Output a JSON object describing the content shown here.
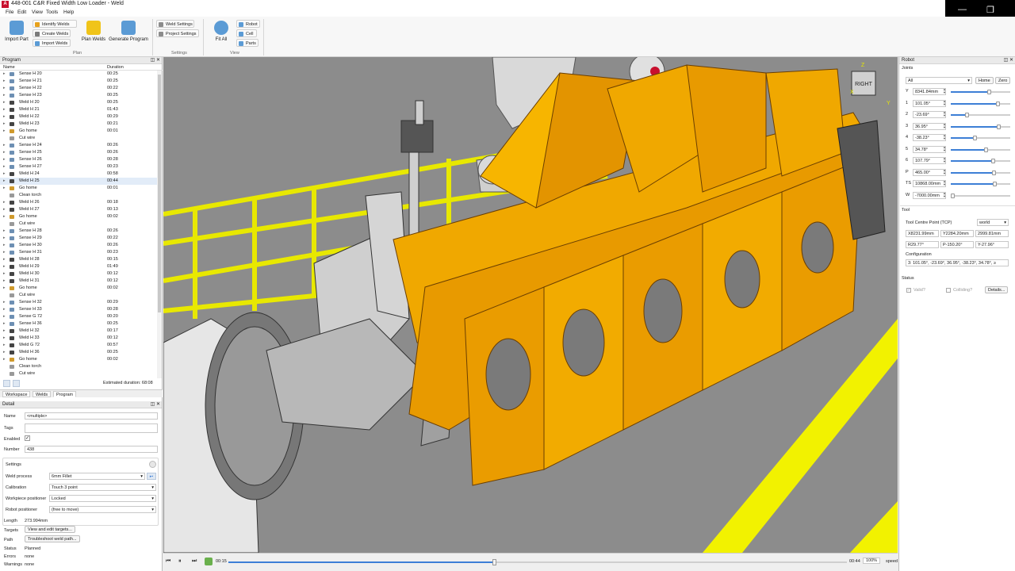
{
  "window": {
    "title": "448-001 C&R Fixed Width Low Loader - Weld",
    "app_icon": "A",
    "minimize": "—",
    "restore": "❐"
  },
  "menu": [
    "File",
    "Edit",
    "View",
    "Tools",
    "Help"
  ],
  "ribbon": {
    "import_part": "Import Part",
    "identify_welds": "Identify Welds",
    "create_welds": "Create Welds",
    "import_welds": "Import Welds",
    "plan_welds": "Plan Welds",
    "generate_program": "Generate Program",
    "group_plan": "Plan",
    "weld_settings": "Weld Settings",
    "project_settings": "Project Settings",
    "group_settings": "Settings",
    "fit_all": "Fit All",
    "robot": "Robot",
    "cell": "Cell",
    "parts": "Parts",
    "group_view": "View"
  },
  "program": {
    "title": "Program",
    "col_name": "Name",
    "col_duration": "Duration",
    "rows": [
      {
        "name": "Sense H 20",
        "duration": "00:25",
        "kind": "sense"
      },
      {
        "name": "Sense H 21",
        "duration": "00:25",
        "kind": "sense"
      },
      {
        "name": "Sense H 22",
        "duration": "00:22",
        "kind": "sense"
      },
      {
        "name": "Sense H 23",
        "duration": "00:25",
        "kind": "sense"
      },
      {
        "name": "Weld H 20",
        "duration": "00:25",
        "kind": "weld"
      },
      {
        "name": "Weld H 21",
        "duration": "01:43",
        "kind": "weld"
      },
      {
        "name": "Weld H 22",
        "duration": "00:29",
        "kind": "weld"
      },
      {
        "name": "Weld H 23",
        "duration": "00:21",
        "kind": "weld"
      },
      {
        "name": "Go home",
        "duration": "00:01",
        "kind": "home"
      },
      {
        "name": "Cut wire",
        "duration": "",
        "kind": "tool"
      },
      {
        "name": "Sense H 24",
        "duration": "00:26",
        "kind": "sense"
      },
      {
        "name": "Sense H 25",
        "duration": "00:26",
        "kind": "sense"
      },
      {
        "name": "Sense H 26",
        "duration": "00:28",
        "kind": "sense"
      },
      {
        "name": "Sense H 27",
        "duration": "00:23",
        "kind": "sense"
      },
      {
        "name": "Weld H 24",
        "duration": "00:58",
        "kind": "weld"
      },
      {
        "name": "Weld H 25",
        "duration": "00:44",
        "kind": "weld",
        "selected": true
      },
      {
        "name": "Go home",
        "duration": "00:01",
        "kind": "home"
      },
      {
        "name": "Clean torch",
        "duration": "",
        "kind": "tool"
      },
      {
        "name": "Weld H 26",
        "duration": "00:18",
        "kind": "weld"
      },
      {
        "name": "Weld H 27",
        "duration": "00:13",
        "kind": "weld"
      },
      {
        "name": "Go home",
        "duration": "00:02",
        "kind": "home"
      },
      {
        "name": "Cut wire",
        "duration": "",
        "kind": "tool"
      },
      {
        "name": "Sense H 28",
        "duration": "00:26",
        "kind": "sense"
      },
      {
        "name": "Sense H 29",
        "duration": "00:22",
        "kind": "sense"
      },
      {
        "name": "Sense H 30",
        "duration": "00:26",
        "kind": "sense"
      },
      {
        "name": "Sense H 31",
        "duration": "00:23",
        "kind": "sense"
      },
      {
        "name": "Weld H 28",
        "duration": "00:15",
        "kind": "weld"
      },
      {
        "name": "Weld H 29",
        "duration": "01:49",
        "kind": "weld"
      },
      {
        "name": "Weld H 30",
        "duration": "00:12",
        "kind": "weld"
      },
      {
        "name": "Weld H 31",
        "duration": "00:12",
        "kind": "weld"
      },
      {
        "name": "Go home",
        "duration": "00:02",
        "kind": "home"
      },
      {
        "name": "Cut wire",
        "duration": "",
        "kind": "tool"
      },
      {
        "name": "Sense H 32",
        "duration": "00:29",
        "kind": "sense"
      },
      {
        "name": "Sense H 33",
        "duration": "00:28",
        "kind": "sense"
      },
      {
        "name": "Sense G 72",
        "duration": "00:20",
        "kind": "sense"
      },
      {
        "name": "Sense H 36",
        "duration": "00:25",
        "kind": "sense"
      },
      {
        "name": "Weld H 32",
        "duration": "00:17",
        "kind": "weld"
      },
      {
        "name": "Weld H 33",
        "duration": "00:12",
        "kind": "weld"
      },
      {
        "name": "Weld G 72",
        "duration": "00:57",
        "kind": "weld"
      },
      {
        "name": "Weld H 36",
        "duration": "00:25",
        "kind": "weld"
      },
      {
        "name": "Go home",
        "duration": "00:02",
        "kind": "home"
      },
      {
        "name": "Clean torch",
        "duration": "",
        "kind": "tool"
      },
      {
        "name": "Cut wire",
        "duration": "",
        "kind": "tool"
      }
    ],
    "estimated": "Estimated duration: 68:08"
  },
  "tabs": [
    "Workspace",
    "Welds",
    "Program"
  ],
  "detail": {
    "title": "Detail",
    "name_label": "Name",
    "name_value": "<multiple>",
    "tags_label": "Tags",
    "enabled_label": "Enabled",
    "number_label": "Number",
    "number_value": "438",
    "settings_label": "Settings",
    "weld_process_label": "Weld process",
    "weld_process_value": "6mm Fillet",
    "calibration_label": "Calibration",
    "calibration_value": "Touch 3 point",
    "workpiece_positioner_label": "Workpiece positioner",
    "workpiece_positioner_value": "Locked",
    "robot_positioner_label": "Robot positioner",
    "robot_positioner_value": "(free to move)",
    "length_label": "Length",
    "length_value": "273.994mm",
    "targets_label": "Targets",
    "targets_button": "View and edit targets...",
    "path_label": "Path",
    "path_button": "Troubleshoot weld path...",
    "status_label": "Status",
    "status_value": "Planned",
    "errors_label": "Errors",
    "errors_value": "none",
    "warnings_label": "Warnings",
    "warnings_value": "none"
  },
  "robot": {
    "title": "Robot",
    "joints_label": "Joints",
    "select_value": "All",
    "home_button": "Home",
    "zero_button": "Zero",
    "joints": [
      {
        "name": "Y",
        "value": "8341.84mm",
        "level": 0.64
      },
      {
        "name": "1",
        "value": "101.05°",
        "level": 0.78
      },
      {
        "name": "2",
        "value": "-23.69°",
        "level": 0.27
      },
      {
        "name": "3",
        "value": "36.95°",
        "level": 0.8
      },
      {
        "name": "4",
        "value": "-38.23°",
        "level": 0.4
      },
      {
        "name": "5",
        "value": "34.78°",
        "level": 0.58
      },
      {
        "name": "6",
        "value": "107.79°",
        "level": 0.7
      },
      {
        "name": "P",
        "value": "465.00°",
        "level": 0.72
      },
      {
        "name": "TS",
        "value": "10868.00mm",
        "level": 0.73
      },
      {
        "name": "W",
        "value": "-7000.00mm",
        "level": 0.03
      }
    ],
    "tool_label": "Tool",
    "tcp_label": "Tool Centre Point (TCP)",
    "frame_value": "world",
    "x_value": "X8231.99mm",
    "yv_value": "Y2284.20mm",
    "z_value": "2999.81mm",
    "r_value": "R29.77°",
    "p_value": "P-150.20°",
    "yaw_value": "Y-27.96°",
    "configuration_label": "Configuration",
    "configuration_value": "3: 101.05°, -23.69°, 36.95°, -38.23°, 34.78°, ≥",
    "status_label": "Status",
    "valid_label": "Valid?",
    "colliding_label": "Colliding?",
    "details_button": "Details..."
  },
  "timeline": {
    "start": "00:15",
    "end": "00:44",
    "zoom": "100%",
    "speed_label": "speed",
    "progress": 0.43
  },
  "viewport": {
    "view_label": "RIGHT",
    "axis_x": "X",
    "axis_y": "Y",
    "axis_z": "Z"
  }
}
